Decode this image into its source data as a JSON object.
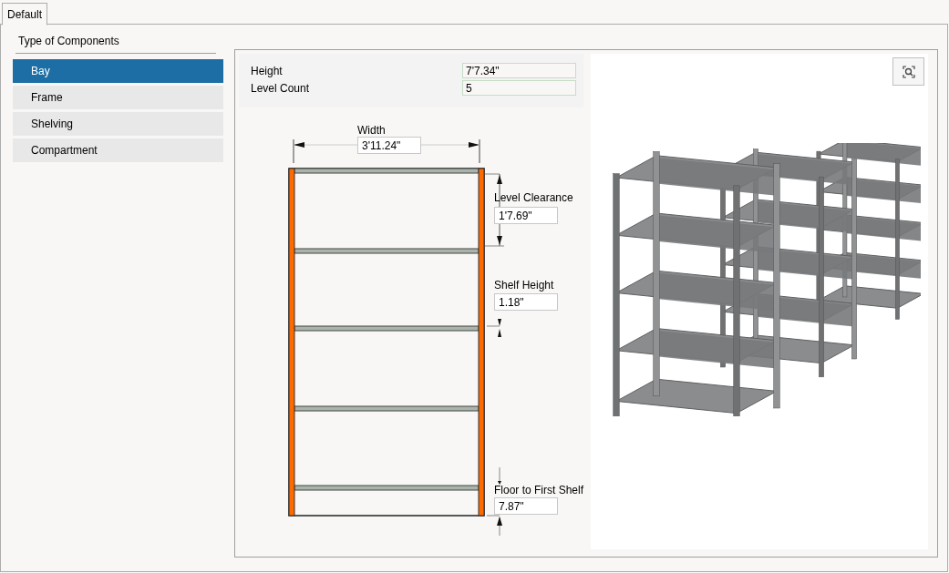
{
  "tabs": [
    {
      "label": "Default",
      "selected": true
    }
  ],
  "sidebar": {
    "title": "Type of Components",
    "items": [
      {
        "label": "Bay",
        "selected": true
      },
      {
        "label": "Frame",
        "selected": false
      },
      {
        "label": "Shelving",
        "selected": false
      },
      {
        "label": "Compartment",
        "selected": false
      }
    ]
  },
  "properties": [
    {
      "label": "Height",
      "value": "7'7.34\""
    },
    {
      "label": "Level Count",
      "value": "5"
    }
  ],
  "diagram": {
    "width": {
      "label": "Width",
      "value": "3'11.24\""
    },
    "level_clearance": {
      "label": "Level Clearance",
      "value": "1'7.69\""
    },
    "shelf_height": {
      "label": "Shelf Height",
      "value": "1.18\""
    },
    "floor_to_first_shelf": {
      "label": "Floor to First Shelf",
      "value": "7.87\""
    }
  }
}
